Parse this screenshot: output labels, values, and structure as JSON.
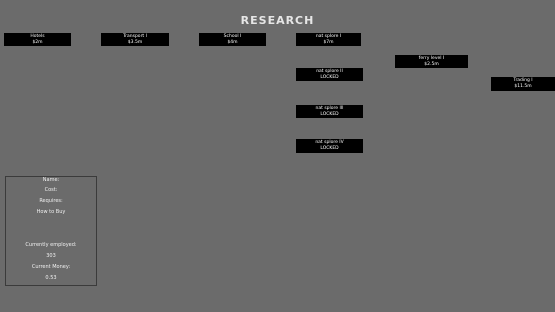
{
  "header": {
    "title": "RESEARCH"
  },
  "tree": {
    "hotels": {
      "label": "Hotels",
      "cost": "$2m"
    },
    "transport": {
      "label": "Transport I",
      "cost": "$3.5m"
    },
    "school": {
      "label": "School I",
      "cost": "$4m"
    },
    "nat_splore_1": {
      "label": "nat splore I",
      "cost": "$7m"
    },
    "nat_splore_2": {
      "label": "nat splore II",
      "status": "LOCKED"
    },
    "nat_splore_3": {
      "label": "nat splore III",
      "status": "LOCKED"
    },
    "nat_splore_4": {
      "label": "nat splore IV",
      "status": "LOCKED"
    },
    "ferry": {
      "label": "ferry level I",
      "cost": "$2.5m"
    },
    "trading": {
      "label": "Trading I",
      "cost": "$11.5m"
    }
  },
  "info_panel": {
    "name_label": "Name:",
    "cost_label": "Cost:",
    "requires_label": "Requires:",
    "how_to_buy_label": "How to Buy",
    "currently_employed_label": "Currently employed:",
    "currently_employed_value": "303",
    "current_money_label": "Current Money:",
    "current_money_value": "0.53"
  }
}
